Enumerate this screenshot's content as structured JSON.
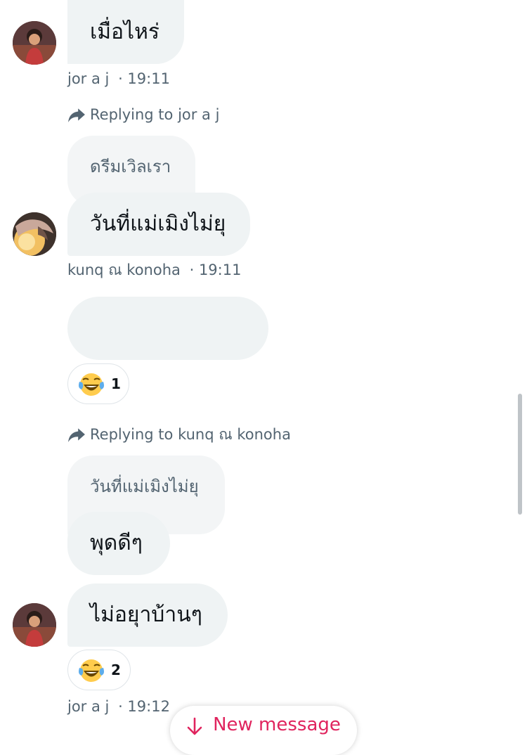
{
  "messages": [
    {
      "text": "เมื่อไหร่",
      "author": "jor a j",
      "time": "· 19:11"
    },
    {
      "reply_to": "Replying to jor a j",
      "quoted": "ดรีมเวิลเรา",
      "text": "วันที่แม่เมิงไม่ยุ",
      "author": "kunq ณ konoha",
      "time": "· 19:11"
    },
    {
      "text": "",
      "reaction": {
        "emoji": "laughing-tears",
        "count": "1"
      }
    },
    {
      "reply_to": "Replying to kunq ณ konoha",
      "quoted": "วันที่แม่เมิงไม่ยุ",
      "text": "พุดดีๆ"
    },
    {
      "text": "ไม่อยุาบ้านๆ",
      "reaction": {
        "emoji": "laughing-tears",
        "count": "2"
      },
      "author": "jor a j",
      "time": "· 19:12"
    }
  ],
  "new_message_button": {
    "label": "New message",
    "icon": "arrow-down-icon"
  },
  "colors": {
    "bubble": "#eff3f4",
    "meta_text": "#536471",
    "accent": "#e0245e"
  }
}
